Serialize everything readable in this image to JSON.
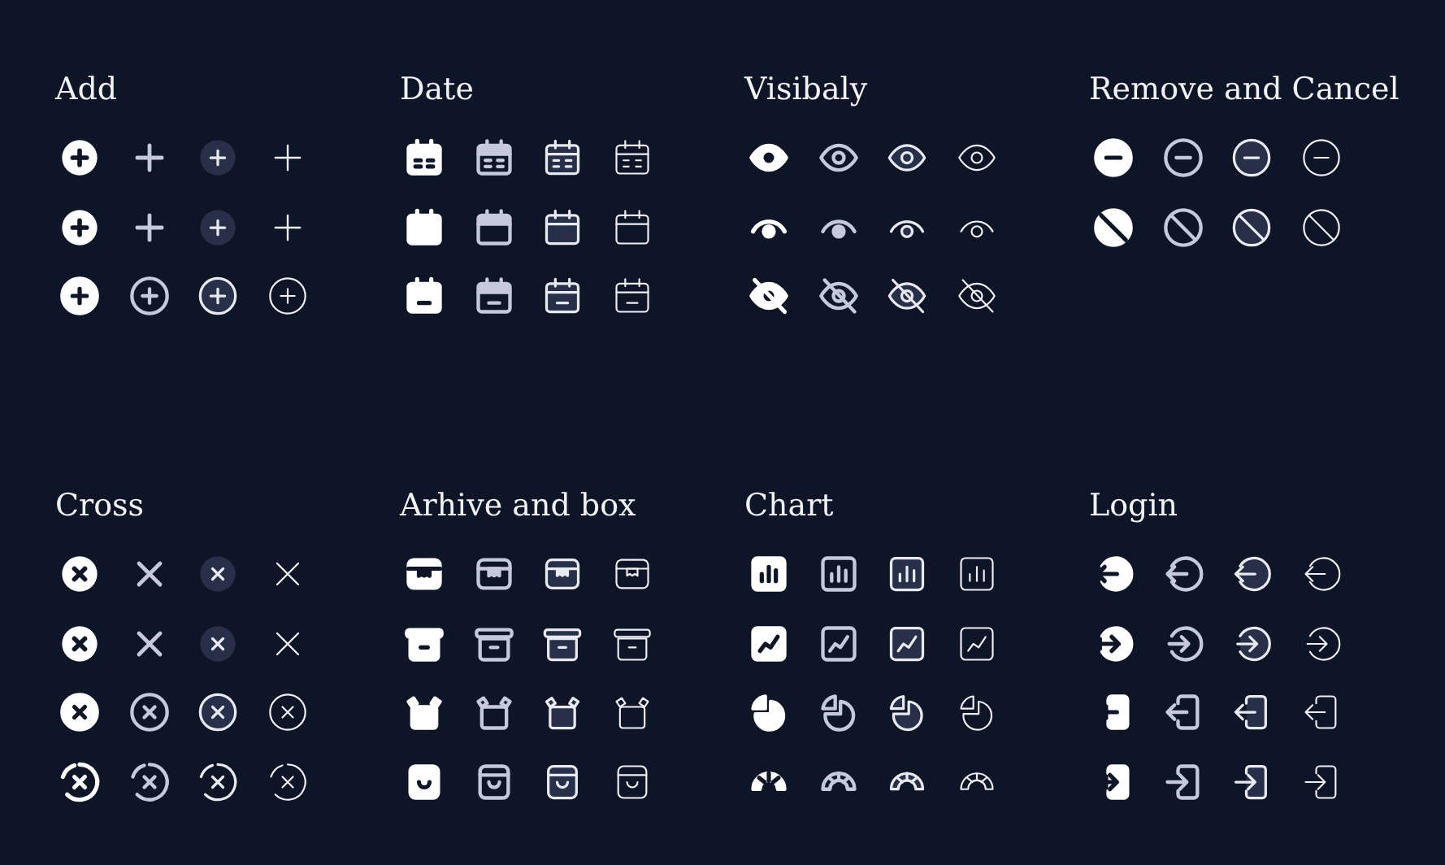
{
  "sections": [
    {
      "title": "Add",
      "kind": "add"
    },
    {
      "title": "Date",
      "kind": "date"
    },
    {
      "title": "Visibaly",
      "kind": "visibility"
    },
    {
      "title": "Remove and Cancel",
      "kind": "remove"
    },
    {
      "title": "Cross",
      "kind": "cross"
    },
    {
      "title": "Arhive and box",
      "kind": "archive"
    },
    {
      "title": "Chart",
      "kind": "chart"
    },
    {
      "title": "Login",
      "kind": "login"
    }
  ]
}
